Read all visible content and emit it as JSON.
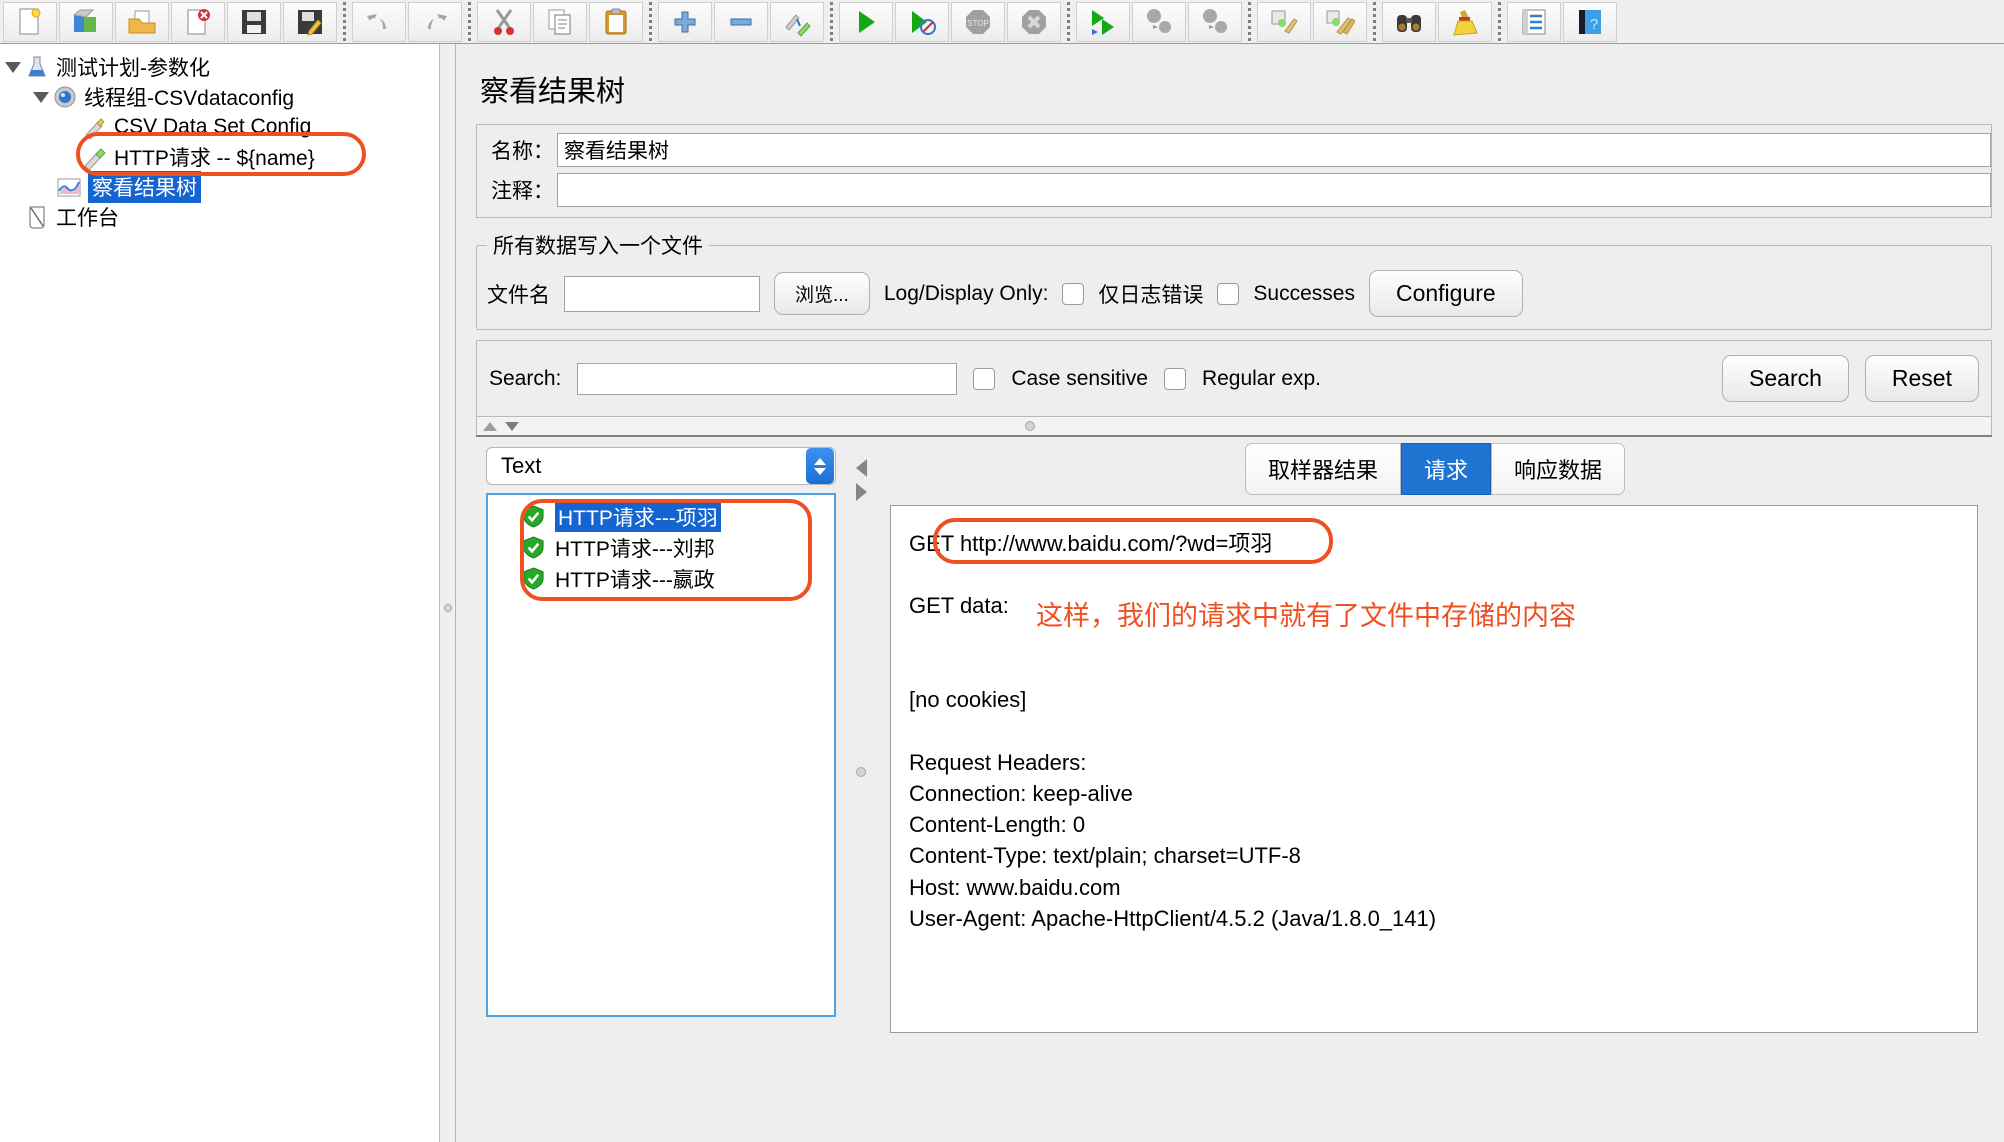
{
  "toolbar": {
    "buttons": [
      {
        "name": "new-test-plan",
        "icon": "new-document-icon"
      },
      {
        "name": "templates",
        "icon": "templates-icon"
      },
      {
        "name": "open",
        "icon": "open-folder-icon"
      },
      {
        "name": "close",
        "icon": "close-document-icon"
      },
      {
        "name": "save",
        "icon": "save-disk-icon"
      },
      {
        "name": "save-as",
        "icon": "save-as-icon"
      },
      {
        "name": "undo",
        "icon": "undo-arrow-icon"
      },
      {
        "name": "redo",
        "icon": "redo-arrow-icon"
      },
      {
        "name": "cut",
        "icon": "scissors-icon"
      },
      {
        "name": "copy",
        "icon": "copy-icon"
      },
      {
        "name": "paste",
        "icon": "clipboard-paste-icon"
      },
      {
        "name": "expand-all",
        "icon": "plus-icon"
      },
      {
        "name": "collapse-all",
        "icon": "minus-icon"
      },
      {
        "name": "toggle",
        "icon": "toggle-pin-icon"
      },
      {
        "name": "start",
        "icon": "start-play-icon"
      },
      {
        "name": "start-no-timers",
        "icon": "start-no-timers-icon"
      },
      {
        "name": "stop",
        "icon": "stop-sign-icon"
      },
      {
        "name": "shutdown",
        "icon": "shutdown-x-icon"
      },
      {
        "name": "remote-start-all",
        "icon": "remote-start-all-icon"
      },
      {
        "name": "remote-stop-all",
        "icon": "remote-stop-all-icon"
      },
      {
        "name": "remote-shutdown-all",
        "icon": "remote-shutdown-all-icon"
      },
      {
        "name": "clear",
        "icon": "clear-broom-icon"
      },
      {
        "name": "clear-all",
        "icon": "clear-all-broom-icon"
      },
      {
        "name": "search",
        "icon": "binoculars-icon"
      },
      {
        "name": "reset-search",
        "icon": "yellow-broom-icon"
      },
      {
        "name": "function-helper",
        "icon": "function-list-icon"
      },
      {
        "name": "help",
        "icon": "help-book-icon"
      }
    ]
  },
  "tree": {
    "nodes": [
      {
        "label": "测试计划-参数化",
        "icon": "test-plan-flask-icon",
        "depth": 0,
        "expanded": true,
        "selected": false
      },
      {
        "label": "线程组-CSVdataconfig",
        "icon": "thread-group-gear-icon",
        "depth": 1,
        "expanded": true,
        "selected": false
      },
      {
        "label": "CSV Data Set Config",
        "icon": "config-element-icon",
        "depth": 2,
        "expanded": false,
        "selected": false
      },
      {
        "label": "HTTP请求 -- ${name}",
        "icon": "http-sampler-icon",
        "depth": 2,
        "expanded": false,
        "selected": false
      },
      {
        "label": "察看结果树",
        "icon": "view-results-tree-icon",
        "depth": 2,
        "expanded": false,
        "selected": true
      },
      {
        "label": "工作台",
        "icon": "workbench-icon",
        "depth": 0,
        "expanded": false,
        "selected": false
      }
    ]
  },
  "panel": {
    "title": "察看结果树",
    "name_label": "名称：",
    "name_value": "察看结果树",
    "comment_label": "注释：",
    "comment_value": ""
  },
  "file_group": {
    "legend": "所有数据写入一个文件",
    "filename_label": "文件名",
    "filename_value": "",
    "browse_button": "浏览...",
    "log_display_label": "Log/Display Only:",
    "errors_only_label": "仅日志错误",
    "errors_only_checked": false,
    "successes_label": "Successes",
    "successes_checked": false,
    "configure_button": "Configure"
  },
  "search": {
    "label": "Search:",
    "value": "",
    "case_sensitive_label": "Case sensitive",
    "case_sensitive_checked": false,
    "regular_exp_label": "Regular exp.",
    "regular_exp_checked": false,
    "search_button": "Search",
    "reset_button": "Reset"
  },
  "results": {
    "renderer_selected": "Text",
    "items": [
      {
        "label": "HTTP请求---项羽",
        "status": "success",
        "selected": true
      },
      {
        "label": "HTTP请求---刘邦",
        "status": "success",
        "selected": false
      },
      {
        "label": "HTTP请求---嬴政",
        "status": "success",
        "selected": false
      }
    ]
  },
  "detail_tabs": [
    {
      "label": "取样器结果",
      "active": false
    },
    {
      "label": "请求",
      "active": true
    },
    {
      "label": "响应数据",
      "active": false
    }
  ],
  "request_body": {
    "lines": [
      "GET http://www.baidu.com/?wd=项羽",
      "",
      "GET data:",
      "",
      "",
      "[no cookies]",
      "",
      "Request Headers:",
      "Connection: keep-alive",
      "Content-Length: 0",
      "Content-Type: text/plain; charset=UTF-8",
      "Host: www.baidu.com",
      "User-Agent: Apache-HttpClient/4.5.2 (Java/1.8.0_141)"
    ]
  },
  "annotation": {
    "text": "这样，我们的请求中就有了文件中存储的内容",
    "color": "#ef5022"
  },
  "colors": {
    "highlight": "#ef5022",
    "selection_blue": "#1464d2",
    "tab_active": "#1f74d2"
  }
}
